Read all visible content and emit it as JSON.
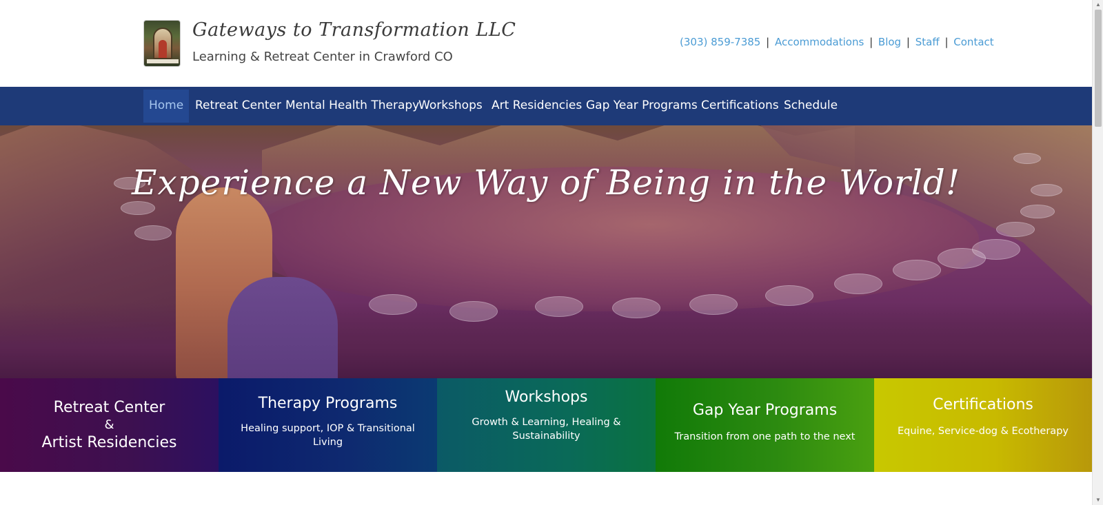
{
  "header": {
    "title": "Gateways to Transformation LLC",
    "tagline": "Learning & Retreat Center in Crawford CO",
    "logo_icon": "archway-garden-logo",
    "links": {
      "phone": "(303) 859-7385",
      "accommodations": "Accommodations",
      "blog": "Blog",
      "staff": "Staff",
      "contact": "Contact",
      "separator": "|"
    }
  },
  "nav": {
    "items": [
      {
        "label": "Home",
        "active": true
      },
      {
        "label": "Retreat Center"
      },
      {
        "label": "Mental Health Therapy"
      },
      {
        "label": "Workshops"
      },
      {
        "label": "Art Residencies"
      },
      {
        "label": "Gap Year Programs"
      },
      {
        "label": "Certifications"
      },
      {
        "label": "Schedule"
      }
    ]
  },
  "hero": {
    "title": "Experience a New Way of Being in the World!"
  },
  "features": [
    {
      "title_line1": "Retreat Center",
      "title_amp": "&",
      "title_line2": "Artist Residencies"
    },
    {
      "title": "Therapy Programs",
      "subtitle": "Healing support, IOP & Transitional Living"
    },
    {
      "title": "Workshops",
      "subtitle": "Growth & Learning, Healing & Sustainability"
    },
    {
      "title": "Gap Year Programs",
      "subtitle": "Transition from one path to the next"
    },
    {
      "title": "Certifications",
      "subtitle": "Equine, Service-dog & Ecotherapy"
    }
  ],
  "colors": {
    "nav_bg": "#1e3a78",
    "link": "#4a9bd4",
    "retreat_box": "#4a0a4a",
    "therapy_box": "#0b1a6a",
    "workshops_box": "#0b5a66",
    "gap_year_box": "#117a08",
    "certifications_box": "#c8c800"
  }
}
